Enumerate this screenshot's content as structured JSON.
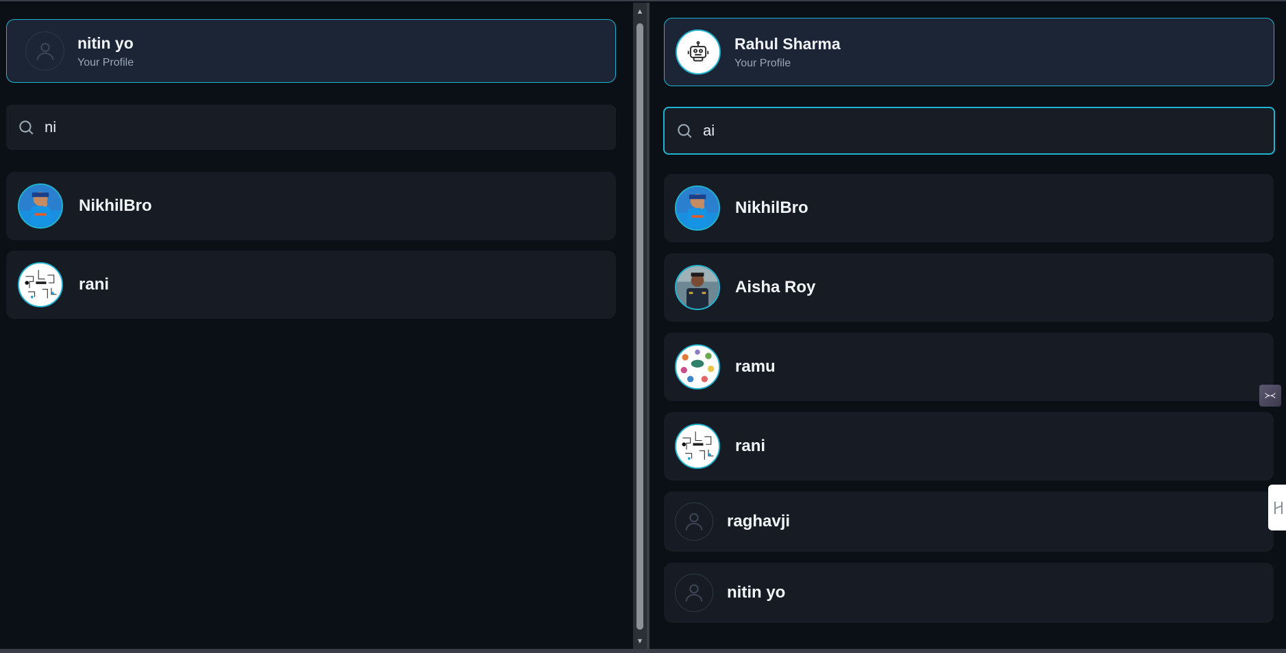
{
  "left_panel": {
    "profile": {
      "name": "nitin yo",
      "subtitle": "Your Profile",
      "avatar": "user-placeholder-icon"
    },
    "search": {
      "value": "ni",
      "icon": "search-icon"
    },
    "contacts": [
      {
        "name": "NikhilBro",
        "avatar": "photo"
      },
      {
        "name": "rani",
        "avatar": "photo"
      }
    ]
  },
  "right_panel": {
    "profile": {
      "name": "Rahul Sharma",
      "subtitle": "Your Profile",
      "avatar": "robot-icon"
    },
    "search": {
      "value": "ai",
      "icon": "search-icon"
    },
    "contacts": [
      {
        "name": "NikhilBro",
        "avatar": "photo"
      },
      {
        "name": "Aisha Roy",
        "avatar": "photo"
      },
      {
        "name": "ramu",
        "avatar": "photo"
      },
      {
        "name": "rani",
        "avatar": "photo"
      },
      {
        "name": "raghavji",
        "avatar": "user-placeholder-icon"
      },
      {
        "name": "nitin yo",
        "avatar": "user-placeholder-icon"
      }
    ]
  },
  "widgets": {
    "side_widget_glyph": "≻≺",
    "side_tab_icon": "h-icon"
  },
  "colors": {
    "accent": "#1fb6d3",
    "background": "#0b0f16",
    "card": "#171c24",
    "profile_card": "#1b2535"
  }
}
